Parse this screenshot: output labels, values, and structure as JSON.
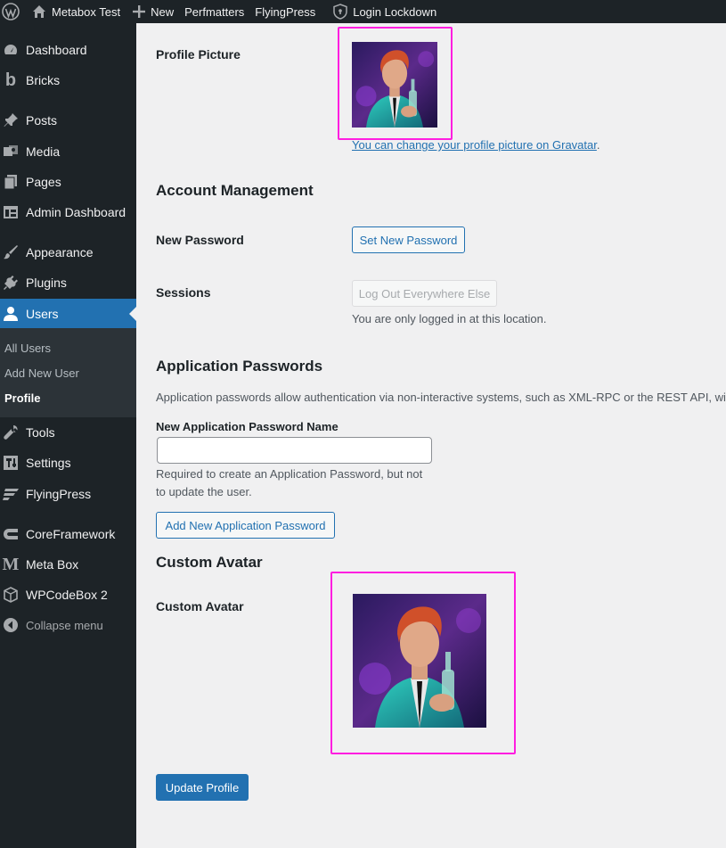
{
  "adminbar": {
    "site_name": "Metabox Test",
    "new_label": "New",
    "perfmatters_label": "Perfmatters",
    "flyingpress_label": "FlyingPress",
    "login_lockdown_label": "Login Lockdown"
  },
  "sidebar": {
    "items": [
      {
        "label": "Dashboard",
        "icon": "dashboard-icon"
      },
      {
        "label": "Bricks",
        "icon": "bricks-icon"
      },
      {
        "label": "Posts",
        "icon": "pin-icon"
      },
      {
        "label": "Media",
        "icon": "media-icon"
      },
      {
        "label": "Pages",
        "icon": "pages-icon"
      },
      {
        "label": "Admin Dashboard",
        "icon": "table-icon"
      },
      {
        "label": "Appearance",
        "icon": "brush-icon"
      },
      {
        "label": "Plugins",
        "icon": "plugin-icon"
      },
      {
        "label": "Users",
        "icon": "user-icon"
      },
      {
        "label": "Tools",
        "icon": "wrench-icon"
      },
      {
        "label": "Settings",
        "icon": "settings-icon"
      },
      {
        "label": "FlyingPress",
        "icon": "flyingpress-icon"
      },
      {
        "label": "CoreFramework",
        "icon": "coreframework-icon"
      },
      {
        "label": "Meta Box",
        "icon": "metabox-icon"
      },
      {
        "label": "WPCodeBox 2",
        "icon": "box-icon"
      },
      {
        "label": "Collapse menu",
        "icon": "collapse-icon"
      }
    ],
    "submenu": [
      {
        "label": "All Users"
      },
      {
        "label": "Add New User"
      },
      {
        "label": "Profile"
      }
    ]
  },
  "profile": {
    "picture_label": "Profile Picture",
    "gravatar_text_before": "You can change your profile picture on Gravatar",
    "gravatar_period": "."
  },
  "account": {
    "title": "Account Management",
    "new_password_label": "New Password",
    "set_password_button": "Set New Password",
    "sessions_label": "Sessions",
    "logout_button": "Log Out Everywhere Else",
    "sessions_desc": "You are only logged in at this location."
  },
  "app_passwords": {
    "title": "Application Passwords",
    "desc": "Application passwords allow authentication via non-interactive systems, such as XML-RPC or the REST API, witho",
    "name_label": "New Application Password Name",
    "name_value": "",
    "help_line1": "Required to create an Application Password, but not",
    "help_line2": "to update the user.",
    "add_button": "Add New Application Password"
  },
  "custom_avatar": {
    "title": "Custom Avatar",
    "label": "Custom Avatar"
  },
  "update_button": "Update Profile",
  "colors": {
    "accent": "#2271b1",
    "highlight": "#ff1ee0",
    "sidebar_bg": "#1d2327"
  }
}
